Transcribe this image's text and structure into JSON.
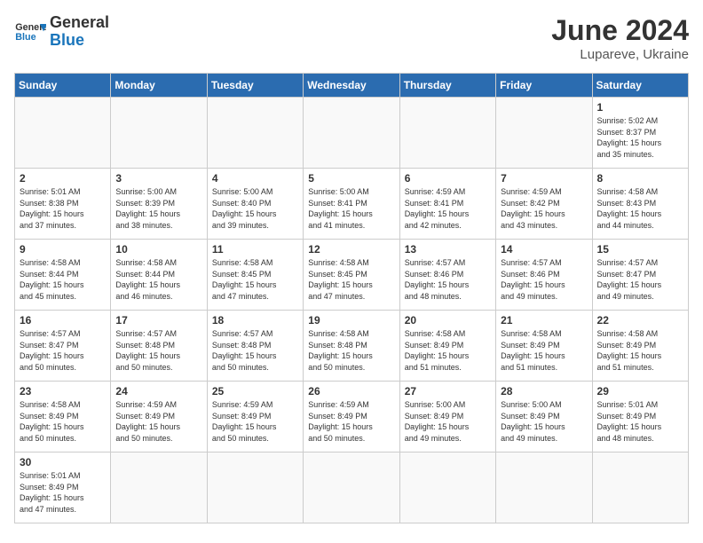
{
  "header": {
    "logo_general": "General",
    "logo_blue": "Blue",
    "month_year": "June 2024",
    "location": "Lupareve, Ukraine"
  },
  "days_of_week": [
    "Sunday",
    "Monday",
    "Tuesday",
    "Wednesday",
    "Thursday",
    "Friday",
    "Saturday"
  ],
  "weeks": [
    [
      {
        "day": "",
        "info": ""
      },
      {
        "day": "",
        "info": ""
      },
      {
        "day": "",
        "info": ""
      },
      {
        "day": "",
        "info": ""
      },
      {
        "day": "",
        "info": ""
      },
      {
        "day": "",
        "info": ""
      },
      {
        "day": "1",
        "info": "Sunrise: 5:02 AM\nSunset: 8:37 PM\nDaylight: 15 hours\nand 35 minutes."
      }
    ],
    [
      {
        "day": "2",
        "info": "Sunrise: 5:01 AM\nSunset: 8:38 PM\nDaylight: 15 hours\nand 37 minutes."
      },
      {
        "day": "3",
        "info": "Sunrise: 5:00 AM\nSunset: 8:39 PM\nDaylight: 15 hours\nand 38 minutes."
      },
      {
        "day": "4",
        "info": "Sunrise: 5:00 AM\nSunset: 8:40 PM\nDaylight: 15 hours\nand 39 minutes."
      },
      {
        "day": "5",
        "info": "Sunrise: 5:00 AM\nSunset: 8:41 PM\nDaylight: 15 hours\nand 41 minutes."
      },
      {
        "day": "6",
        "info": "Sunrise: 4:59 AM\nSunset: 8:41 PM\nDaylight: 15 hours\nand 42 minutes."
      },
      {
        "day": "7",
        "info": "Sunrise: 4:59 AM\nSunset: 8:42 PM\nDaylight: 15 hours\nand 43 minutes."
      },
      {
        "day": "8",
        "info": "Sunrise: 4:58 AM\nSunset: 8:43 PM\nDaylight: 15 hours\nand 44 minutes."
      }
    ],
    [
      {
        "day": "9",
        "info": "Sunrise: 4:58 AM\nSunset: 8:44 PM\nDaylight: 15 hours\nand 45 minutes."
      },
      {
        "day": "10",
        "info": "Sunrise: 4:58 AM\nSunset: 8:44 PM\nDaylight: 15 hours\nand 46 minutes."
      },
      {
        "day": "11",
        "info": "Sunrise: 4:58 AM\nSunset: 8:45 PM\nDaylight: 15 hours\nand 47 minutes."
      },
      {
        "day": "12",
        "info": "Sunrise: 4:58 AM\nSunset: 8:45 PM\nDaylight: 15 hours\nand 47 minutes."
      },
      {
        "day": "13",
        "info": "Sunrise: 4:57 AM\nSunset: 8:46 PM\nDaylight: 15 hours\nand 48 minutes."
      },
      {
        "day": "14",
        "info": "Sunrise: 4:57 AM\nSunset: 8:46 PM\nDaylight: 15 hours\nand 49 minutes."
      },
      {
        "day": "15",
        "info": "Sunrise: 4:57 AM\nSunset: 8:47 PM\nDaylight: 15 hours\nand 49 minutes."
      }
    ],
    [
      {
        "day": "16",
        "info": "Sunrise: 4:57 AM\nSunset: 8:47 PM\nDaylight: 15 hours\nand 50 minutes."
      },
      {
        "day": "17",
        "info": "Sunrise: 4:57 AM\nSunset: 8:48 PM\nDaylight: 15 hours\nand 50 minutes."
      },
      {
        "day": "18",
        "info": "Sunrise: 4:57 AM\nSunset: 8:48 PM\nDaylight: 15 hours\nand 50 minutes."
      },
      {
        "day": "19",
        "info": "Sunrise: 4:58 AM\nSunset: 8:48 PM\nDaylight: 15 hours\nand 50 minutes."
      },
      {
        "day": "20",
        "info": "Sunrise: 4:58 AM\nSunset: 8:49 PM\nDaylight: 15 hours\nand 51 minutes."
      },
      {
        "day": "21",
        "info": "Sunrise: 4:58 AM\nSunset: 8:49 PM\nDaylight: 15 hours\nand 51 minutes."
      },
      {
        "day": "22",
        "info": "Sunrise: 4:58 AM\nSunset: 8:49 PM\nDaylight: 15 hours\nand 51 minutes."
      }
    ],
    [
      {
        "day": "23",
        "info": "Sunrise: 4:58 AM\nSunset: 8:49 PM\nDaylight: 15 hours\nand 50 minutes."
      },
      {
        "day": "24",
        "info": "Sunrise: 4:59 AM\nSunset: 8:49 PM\nDaylight: 15 hours\nand 50 minutes."
      },
      {
        "day": "25",
        "info": "Sunrise: 4:59 AM\nSunset: 8:49 PM\nDaylight: 15 hours\nand 50 minutes."
      },
      {
        "day": "26",
        "info": "Sunrise: 4:59 AM\nSunset: 8:49 PM\nDaylight: 15 hours\nand 50 minutes."
      },
      {
        "day": "27",
        "info": "Sunrise: 5:00 AM\nSunset: 8:49 PM\nDaylight: 15 hours\nand 49 minutes."
      },
      {
        "day": "28",
        "info": "Sunrise: 5:00 AM\nSunset: 8:49 PM\nDaylight: 15 hours\nand 49 minutes."
      },
      {
        "day": "29",
        "info": "Sunrise: 5:01 AM\nSunset: 8:49 PM\nDaylight: 15 hours\nand 48 minutes."
      }
    ],
    [
      {
        "day": "30",
        "info": "Sunrise: 5:01 AM\nSunset: 8:49 PM\nDaylight: 15 hours\nand 47 minutes."
      },
      {
        "day": "",
        "info": ""
      },
      {
        "day": "",
        "info": ""
      },
      {
        "day": "",
        "info": ""
      },
      {
        "day": "",
        "info": ""
      },
      {
        "day": "",
        "info": ""
      },
      {
        "day": "",
        "info": ""
      }
    ]
  ]
}
